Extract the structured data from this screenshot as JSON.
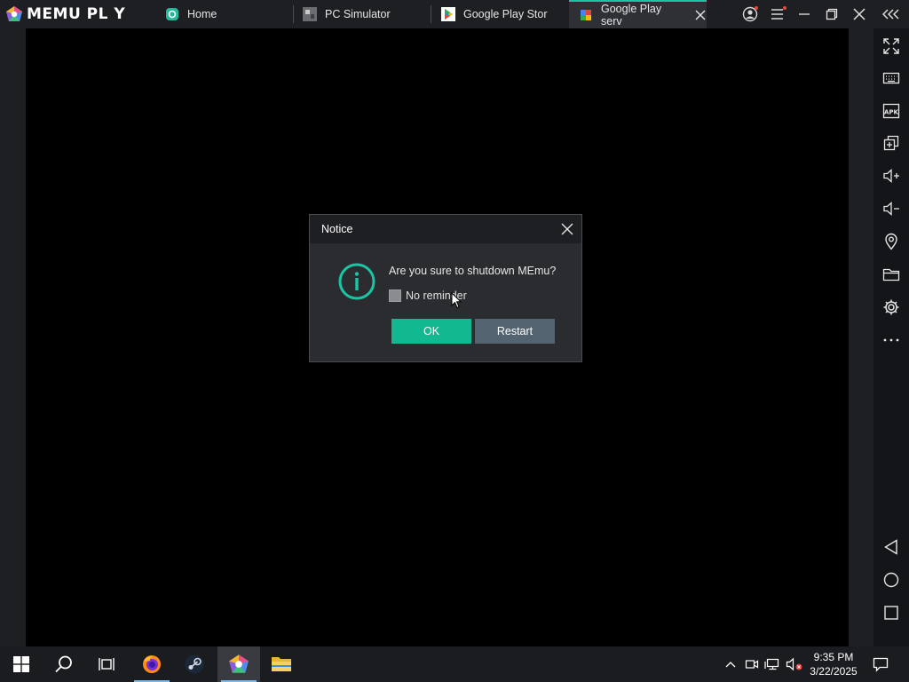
{
  "app": {
    "logo_text": "MEMU PL Y",
    "tabs": [
      {
        "label": "Home",
        "icon": "memu-home-icon"
      },
      {
        "label": "PC Simulator",
        "icon": "pc-simulator-app-icon"
      },
      {
        "label": "Google Play Stor",
        "icon": "google-play-icon"
      },
      {
        "label": "Google Play serv",
        "icon": "google-play-services-icon",
        "active": true
      }
    ]
  },
  "dialog": {
    "title": "Notice",
    "message": "Are you sure to shutdown MEmu?",
    "checkbox_label": "No reminder",
    "checkbox_checked": false,
    "ok_label": "OK",
    "restart_label": "Restart"
  },
  "sidebar": {
    "items": [
      "fullscreen-icon",
      "keyboard-icon",
      "apk-icon",
      "multi-instance-icon",
      "volume-up-icon",
      "volume-down-icon",
      "location-icon",
      "folder-icon",
      "settings-icon",
      "more-icon",
      "back-icon",
      "home-icon",
      "recents-icon"
    ],
    "apk_label": "APK"
  },
  "taskbar": {
    "time": "9:35 PM",
    "date": "3/22/2025"
  },
  "colors": {
    "accent": "#19c6a3",
    "ok_button": "#12b990",
    "restart_button": "#536370"
  }
}
